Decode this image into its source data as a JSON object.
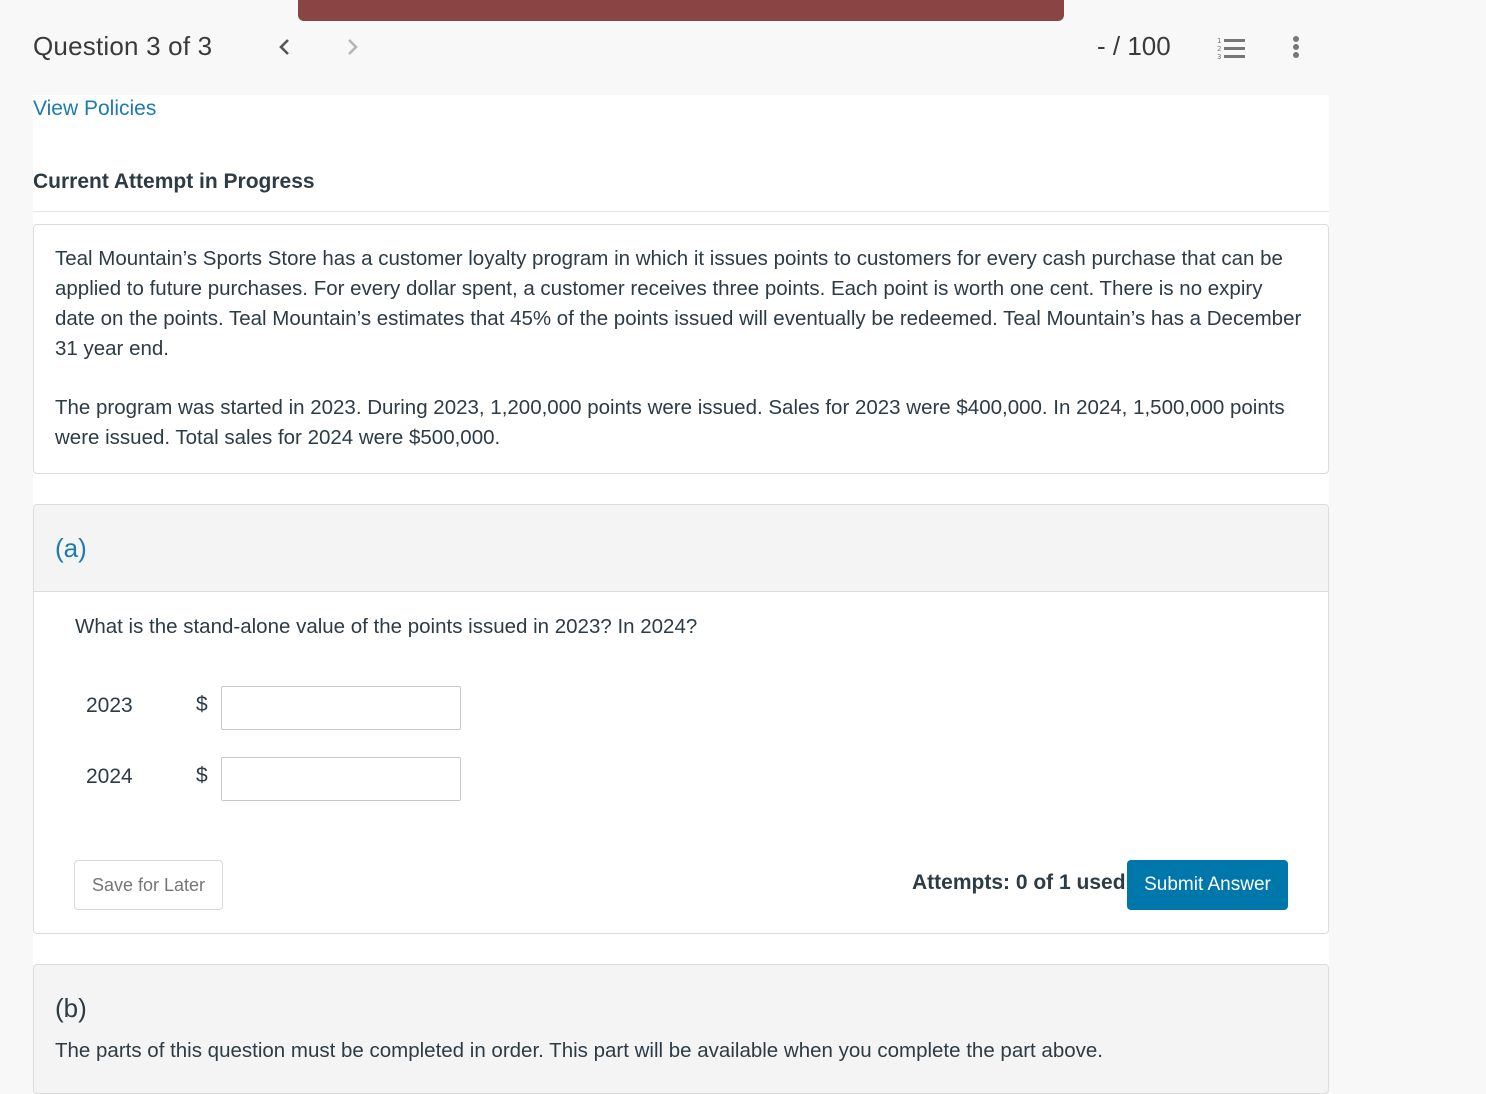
{
  "header": {
    "question_label": "Question 3 of 3",
    "score": "- / 100",
    "icons": {
      "prev": "chevron-left-icon",
      "next": "chevron-right-icon",
      "list": "numbered-list-icon",
      "more": "more-vertical-icon"
    },
    "banner_color": "#8b4444"
  },
  "main": {
    "view_policies": "View Policies",
    "attempt_title": "Current Attempt in Progress",
    "problem_paragraphs": [
      "Teal Mountain’s Sports Store has a customer loyalty program in which it issues points to customers for every cash purchase that can be applied to future purchases. For every dollar spent, a customer receives three points. Each point is worth one cent. There is no expiry date on the points. Teal Mountain’s estimates that 45% of the points issued will eventually be redeemed. Teal Mountain’s has a December 31 year end.",
      "The program was started in 2023. During 2023, 1,200,000 points were issued. Sales for 2023 were $400,000. In 2024, 1,500,000 points were issued. Total sales for 2024 were $500,000."
    ],
    "part_a": {
      "label": "(a)",
      "question": "What is the stand-alone value of the points issued in 2023? In 2024?",
      "rows": [
        {
          "year": "2023",
          "currency": "$",
          "value": ""
        },
        {
          "year": "2024",
          "currency": "$",
          "value": ""
        }
      ],
      "save_label": "Save for Later",
      "attempts": "Attempts: 0 of 1 used",
      "submit_label": "Submit Answer",
      "accent_color": "#0077aa"
    },
    "part_b": {
      "label": "(b)",
      "note": "The parts of this question must be completed in order. This part will be available when you complete the part above."
    }
  }
}
